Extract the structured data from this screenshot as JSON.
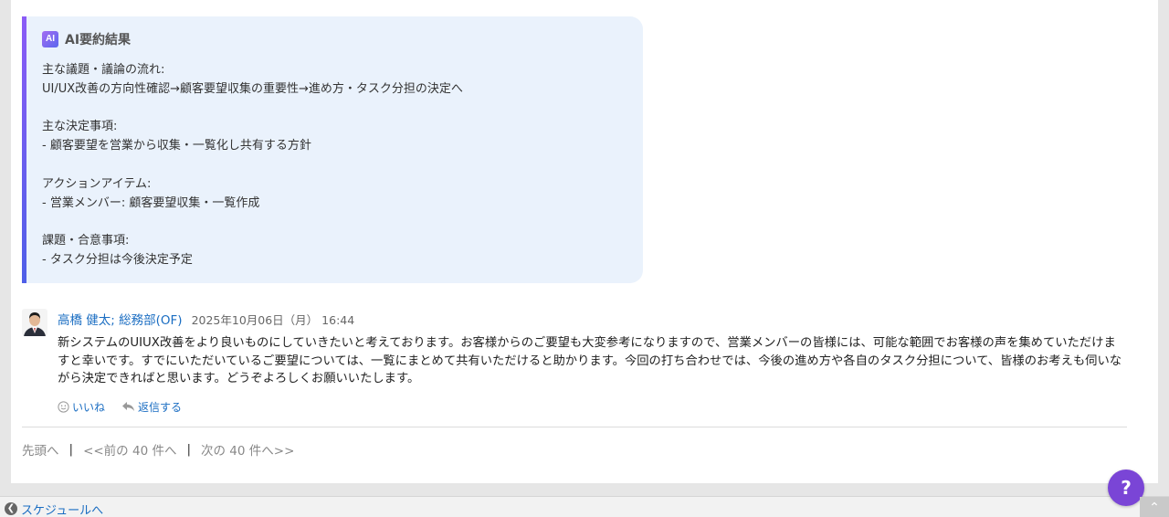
{
  "ai_summary": {
    "badge": "AI",
    "title": "AI要約結果",
    "lines": [
      "主な議題・議論の流れ:",
      "UI/UX改善の方向性確認→顧客要望収集の重要性→進め方・タスク分担の決定へ",
      "",
      "主な決定事項:",
      "- 顧客要望を営業から収集・一覧化し共有する方針",
      "",
      "アクションアイテム:",
      "- 営業メンバー: 顧客要望収集・一覧作成",
      "",
      "課題・合意事項:",
      "- タスク分担は今後決定予定"
    ]
  },
  "comment": {
    "author": "高橋 健太; 総務部(OF)",
    "date": "2025年10月06日（月） 16:44",
    "text": "新システムのUIUX改善をより良いものにしていきたいと考えております。お客様からのご要望も大変参考になりますので、営業メンバーの皆様には、可能な範囲でお客様の声を集めていただけますと幸いです。すでにいただいているご要望については、一覧にまとめて共有いただけると助かります。今回の打ち合わせでは、今後の進め方や各自のタスク分担について、皆様のお考えも伺いながら決定できればと思います。どうぞよろしくお願いいたします。",
    "like_label": "いいね",
    "reply_label": "返信する"
  },
  "pager": {
    "first": "先頭へ",
    "prev": "<<前の 40 件へ",
    "next": "次の 40 件へ>>",
    "separator": "|"
  },
  "footer": {
    "back_label": "スケジュールへ"
  },
  "help": {
    "label": "?"
  },
  "colors": {
    "link": "#1a6dc2",
    "ai_box_bg": "#eaf2fc",
    "help_button": "#7a45d6"
  }
}
